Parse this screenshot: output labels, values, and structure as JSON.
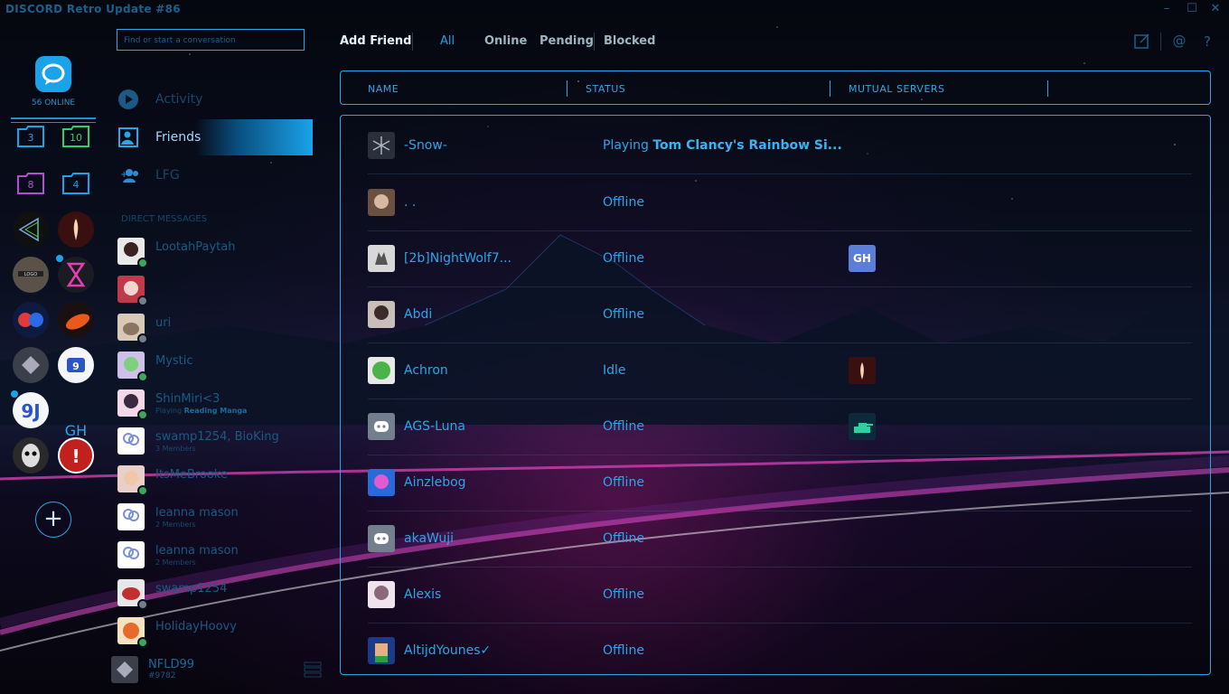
{
  "window": {
    "title": "DISCORD Retro Update #86"
  },
  "rail": {
    "online_count": "56 ONLINE",
    "folders": [
      {
        "count": "3",
        "color": "#1aa3e8"
      },
      {
        "count": "10",
        "color": "#2fd06a"
      },
      {
        "count": "8",
        "color": "#b24fd0"
      },
      {
        "count": "4",
        "color": "#1aa3e8"
      }
    ],
    "text_server": "GH",
    "add_symbol": "+"
  },
  "search": {
    "placeholder": "Find or start a conversation"
  },
  "nav": {
    "activity": "Activity",
    "friends": "Friends",
    "lfg": "LFG"
  },
  "dm_header": "DIRECT MESSAGES",
  "dms": [
    {
      "name": "LootahPaytah",
      "sub": "",
      "status": "online"
    },
    {
      "name": "",
      "sub": "",
      "status": "offline"
    },
    {
      "name": "uri",
      "sub": "",
      "status": "offline"
    },
    {
      "name": "Mystic",
      "sub": "",
      "status": "online"
    },
    {
      "name": "ShinMiri<3",
      "sub_prefix": "Playing",
      "sub_game": "Reading Manga",
      "status": "online"
    },
    {
      "name": "swamp1254, BioKing",
      "sub": "3 Members",
      "status": "group"
    },
    {
      "name": "ItsMeBrooke",
      "sub": "",
      "status": "online"
    },
    {
      "name": "leanna mason",
      "sub": "2 Members",
      "status": "group"
    },
    {
      "name": "leanna mason",
      "sub": "2 Members",
      "status": "group"
    },
    {
      "name": "swamp1254",
      "sub": "",
      "status": "offline"
    },
    {
      "name": "HolidayHoovy",
      "sub": "",
      "status": "online"
    }
  ],
  "user": {
    "name": "NFLD99",
    "tag": "#9782"
  },
  "tabs": {
    "add_friend": "Add Friend",
    "all": "All",
    "online": "Online",
    "pending": "Pending",
    "blocked": "Blocked"
  },
  "table": {
    "headers": {
      "name": "NAME",
      "status": "STATUS",
      "mutual": "MUTUAL SERVERS"
    },
    "rows": [
      {
        "name": "-Snow-",
        "status_prefix": "Playing",
        "status_game": "Tom Clancy's Rainbow Si...",
        "mutual": ""
      },
      {
        "name": ". .",
        "status": "Offline",
        "mutual": ""
      },
      {
        "name": "[2b]NightWolf7...",
        "status": "Offline",
        "mutual": "GH"
      },
      {
        "name": "Abdi",
        "status": "Offline",
        "mutual": ""
      },
      {
        "name": "Achron",
        "status": "Idle",
        "mutual": "server-icon"
      },
      {
        "name": "AGS-Luna",
        "status": "Offline",
        "mutual": "server-icon"
      },
      {
        "name": "Ainzlebog",
        "status": "Offline",
        "mutual": ""
      },
      {
        "name": "akaWuji",
        "status": "Offline",
        "mutual": ""
      },
      {
        "name": "Alexis",
        "status": "Offline",
        "mutual": ""
      },
      {
        "name": "AltijdYounes✓",
        "status": "Offline",
        "mutual": ""
      }
    ]
  },
  "colors": {
    "accent": "#2aa6e8",
    "online": "#3ba55c",
    "offline": "#747f8d"
  }
}
